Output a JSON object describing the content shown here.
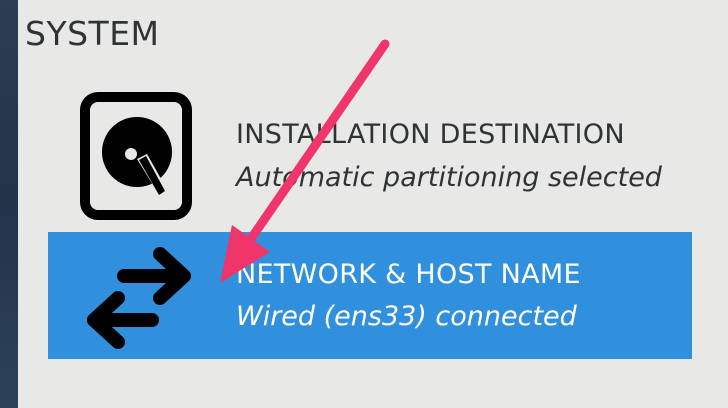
{
  "section": {
    "title": "SYSTEM"
  },
  "spokes": [
    {
      "icon": "hard-disk-icon",
      "label": "INSTALLATION DESTINATION",
      "status": "Automatic partitioning selected"
    },
    {
      "icon": "network-arrows-icon",
      "label": "NETWORK & HOST NAME",
      "status": "Wired (ens33) connected",
      "selected": true
    }
  ],
  "colors": {
    "selected_background": "#3190de",
    "annotation_arrow": "#f0356a",
    "panel_background": "#e8e8e7"
  }
}
